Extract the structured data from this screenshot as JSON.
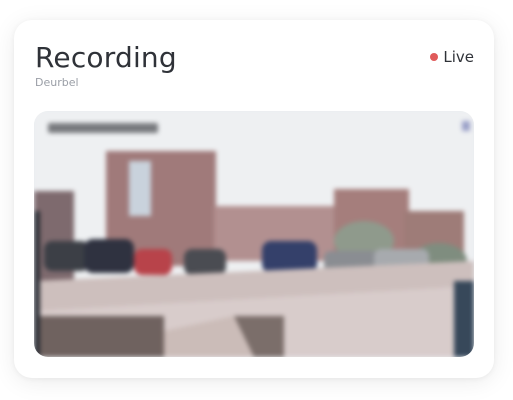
{
  "card": {
    "title": "Recording",
    "subtitle": "Deurbel",
    "status_label": "Live",
    "status_color": "#e05a5a"
  },
  "video": {
    "icon": "camera-feed",
    "blurred": true
  }
}
